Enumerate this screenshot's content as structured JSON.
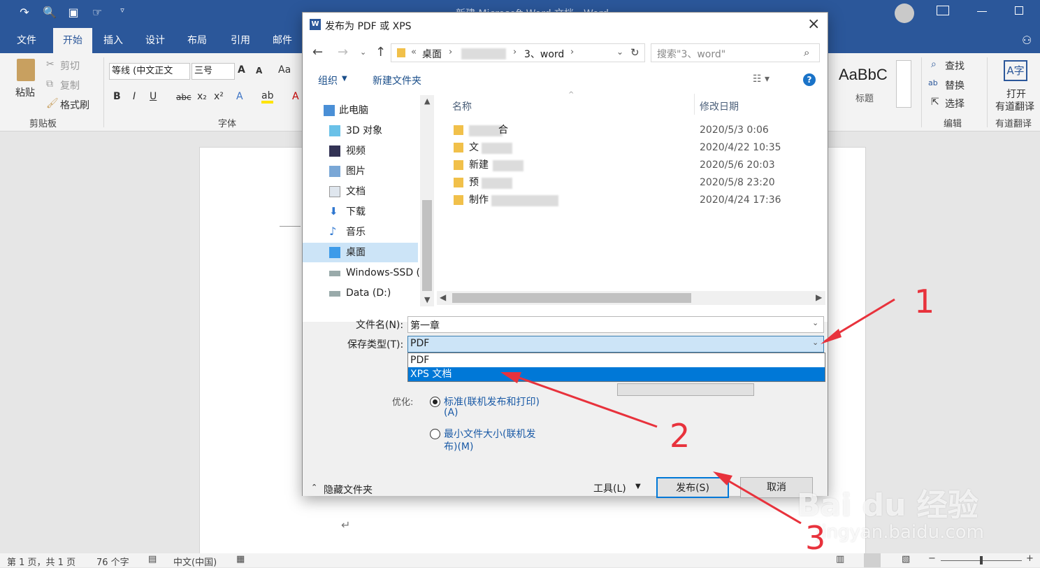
{
  "word": {
    "title": "新建 Microsoft Word 文档 - Word",
    "tabs": [
      "文件",
      "开始",
      "插入",
      "设计",
      "布局",
      "引用",
      "邮件"
    ],
    "ribbon": {
      "paste": "粘贴",
      "cut": "剪切",
      "copy": "复制",
      "format_painter": "格式刷",
      "clipboard_group": "剪贴板",
      "font_name": "等线 (中文正文",
      "font_size": "三号",
      "font_group": "字体",
      "style_sample": "AaBbC",
      "style_name": "标题",
      "find": "查找",
      "replace": "替换",
      "select": "选择",
      "edit_group": "编辑",
      "translate_line1": "打开",
      "translate_line2": "有道翻译",
      "translate_group": "有道翻译"
    },
    "status": {
      "page": "第 1 页，共 1 页",
      "words": "76 个字",
      "language": "中文(中国)"
    }
  },
  "dialog": {
    "title": "发布为 PDF 或 XPS",
    "breadcrumb": [
      "桌面",
      "3、word"
    ],
    "search_placeholder": "搜索\"3、word\"",
    "organize": "组织",
    "new_folder": "新建文件夹",
    "nav": [
      "此电脑",
      "3D 对象",
      "视频",
      "图片",
      "文档",
      "下载",
      "音乐",
      "桌面",
      "Windows-SSD (",
      "Data (D:)"
    ],
    "columns": {
      "name": "名称",
      "date": "修改日期"
    },
    "files": [
      {
        "name": "合",
        "date": "2020/5/3 0:06"
      },
      {
        "name": "文",
        "date": "2020/4/22 10:35"
      },
      {
        "name": "新建",
        "date": "2020/5/6 20:03"
      },
      {
        "name": "预",
        "date": "2020/5/8 23:20"
      },
      {
        "name": "制作",
        "date": "2020/4/24 17:36"
      }
    ],
    "filename_label": "文件名(N):",
    "filename_value": "第一章",
    "filetype_label": "保存类型(T):",
    "filetype_value": "PDF",
    "filetype_options": [
      "PDF",
      "XPS 文档"
    ],
    "optimize_label": "优化:",
    "opt_standard": "标准(联机发布和打印)",
    "opt_standard_key": "(A)",
    "opt_min": "最小文件大小(联机发",
    "opt_min_key": "布)(M)",
    "hide_folders": "隐藏文件夹",
    "tools": "工具(L)",
    "publish": "发布(S)",
    "cancel": "取消"
  },
  "annotations": [
    "1",
    "2",
    "3"
  ],
  "watermark": {
    "brand": "Bai du 经验",
    "url": "jingyan.baidu.com"
  }
}
